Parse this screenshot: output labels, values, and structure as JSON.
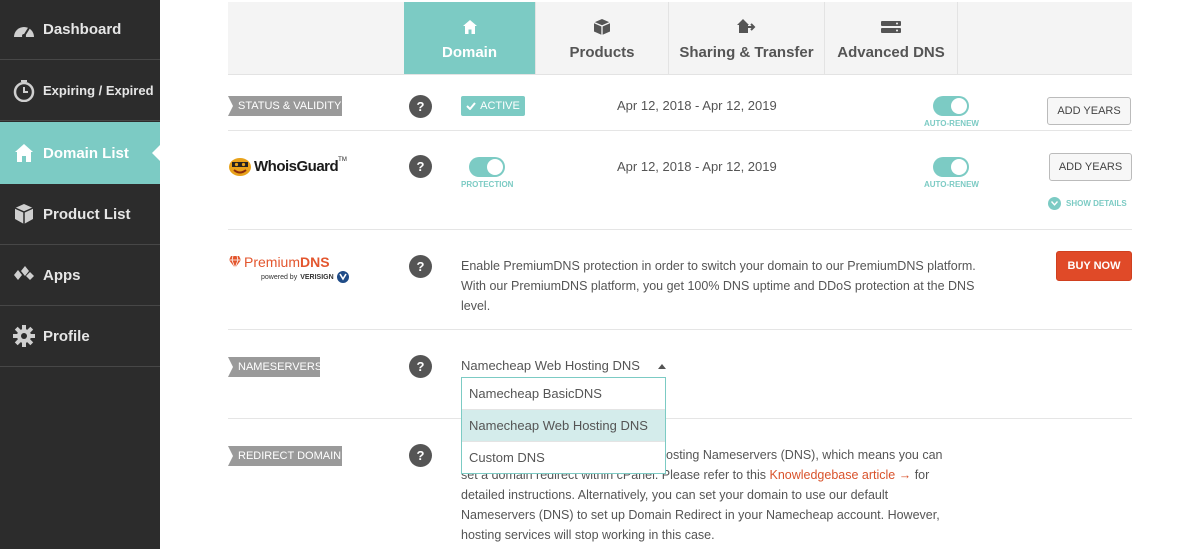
{
  "sidebar": {
    "items": [
      {
        "label": "Dashboard",
        "icon": "speedometer-icon"
      },
      {
        "label": "Expiring / Expired",
        "icon": "clock-icon"
      },
      {
        "label": "Domain List",
        "icon": "home-icon"
      },
      {
        "label": "Product List",
        "icon": "box-icon"
      },
      {
        "label": "Apps",
        "icon": "apps-icon"
      },
      {
        "label": "Profile",
        "icon": "gear-icon"
      }
    ]
  },
  "tabs": [
    {
      "label": "Domain",
      "icon": "home-icon"
    },
    {
      "label": "Products",
      "icon": "box-icon"
    },
    {
      "label": "Sharing & Transfer",
      "icon": "share-home-icon"
    },
    {
      "label": "Advanced DNS",
      "icon": "server-icon"
    }
  ],
  "status": {
    "tag": "STATUS & VALIDITY",
    "help": "?",
    "badge": "ACTIVE",
    "dates": "Apr 12, 2018 - Apr 12, 2019",
    "autorenew_label": "AUTO-RENEW",
    "button": "ADD YEARS"
  },
  "whoisguard": {
    "logo_text": "WhoisGuard",
    "help": "?",
    "protection_label": "PROTECTION",
    "dates": "Apr 12, 2018 - Apr 12, 2019",
    "autorenew_label": "AUTO-RENEW",
    "button": "ADD YEARS",
    "show_details": "SHOW DETAILS"
  },
  "premiumdns": {
    "logo_prefix": "Premium",
    "logo_suffix": "DNS",
    "powered_by": "powered by",
    "verisign": "VERISIGN",
    "help": "?",
    "description": "Enable PremiumDNS protection in order to switch your domain to our PremiumDNS platform. With our PremiumDNS platform, you get 100% DNS uptime and DDoS protection at the DNS level.",
    "button": "BUY NOW"
  },
  "nameservers": {
    "tag": "NAMESERVERS",
    "help": "?",
    "selected": "Namecheap Web Hosting DNS",
    "options": [
      "Namecheap BasicDNS",
      "Namecheap Web Hosting DNS",
      "Custom DNS"
    ]
  },
  "redirect": {
    "tag": "REDIRECT DOMAIN",
    "help": "?",
    "text_1": "osting Nameservers (DNS), which means you can",
    "text_2": "set a domain redirect within cPanel. Please refer to this ",
    "link": "Knowledgebase article →",
    "text_3": " for",
    "text_4": "detailed instructions. Alternatively, you can set your domain to use our default",
    "text_5": "Nameservers (DNS) to set up Domain Redirect in your Namecheap account. However,",
    "text_6": "hosting services will stop working in this case."
  },
  "colors": {
    "accent": "#7ccbc4",
    "sidebar_bg": "#2c2c2c",
    "buy_now": "#e04a28",
    "premium_orange": "#e3562e"
  }
}
